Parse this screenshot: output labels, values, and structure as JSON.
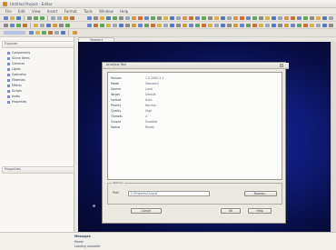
{
  "window": {
    "title": "Untitled Project - Editor"
  },
  "menu": [
    "File",
    "Edit",
    "View",
    "Insert",
    "Format",
    "Tools",
    "Window",
    "Help"
  ],
  "toolbar": {
    "items": [
      {
        "icon": "new-icon",
        "color": "#6c86c7"
      },
      {
        "icon": "open-icon",
        "color": "#d8b24a"
      },
      {
        "icon": "save-icon",
        "color": "#4f79c2"
      },
      {
        "icon": "print-icon",
        "color": "#8a8a8a"
      },
      {
        "icon": "undo-icon",
        "color": "#62a55b"
      },
      {
        "icon": "redo-icon",
        "color": "#62a55b"
      },
      {
        "icon": "zoom-icon",
        "color": "#9da5b8"
      },
      {
        "icon": "grid-icon",
        "color": "#a4a9b3"
      },
      {
        "icon": "layers-icon",
        "color": "#d39a3c"
      },
      {
        "icon": "render-icon",
        "color": "#c46f34"
      }
    ]
  },
  "sidebar": {
    "top_panel_title": "Explorer",
    "items": [
      {
        "label": "Components"
      },
      {
        "label": "Scene Items"
      },
      {
        "label": "Cameras"
      },
      {
        "label": "Lights"
      },
      {
        "label": "Geometry"
      },
      {
        "label": "Materials"
      },
      {
        "label": "Effects"
      },
      {
        "label": "Scripts"
      },
      {
        "label": "Audio"
      },
      {
        "label": "Properties"
      }
    ],
    "bottom_panel_title": "Properties"
  },
  "canvas": {
    "tab_label": "Viewport"
  },
  "dialog": {
    "title": "Analysis Tool",
    "rows": [
      {
        "key": "Version",
        "value": "1.0.2000.3.1"
      },
      {
        "key": "Mode",
        "value": "Standard"
      },
      {
        "key": "Source",
        "value": "Local"
      },
      {
        "key": "Target",
        "value": "Default"
      },
      {
        "key": "Format",
        "value": "Auto"
      },
      {
        "key": "Priority",
        "value": "Normal"
      },
      {
        "key": "Quality",
        "value": "High"
      },
      {
        "key": "Threads",
        "value": "4"
      },
      {
        "key": "Output",
        "value": "Enabled"
      },
      {
        "key": "Status",
        "value": "Ready"
      }
    ],
    "group_title": "Options",
    "field1_label": "Path",
    "field1_value": "C:\\Projects\\Output",
    "browse_button": "Browse...",
    "cancel_button": "Cancel",
    "ok_button": "OK",
    "help_button": "Help"
  },
  "status": {
    "line1": "Messages",
    "line2": "Ready",
    "line3": "Loading complete"
  }
}
